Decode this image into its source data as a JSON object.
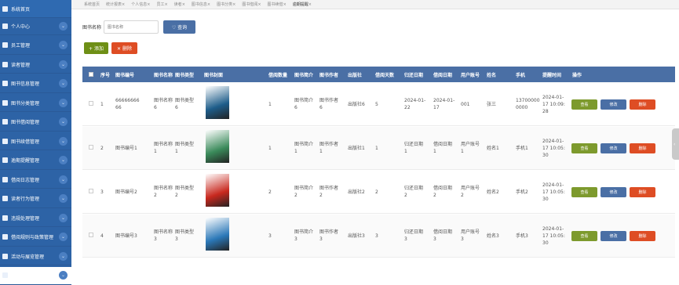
{
  "sidebar": {
    "items": [
      {
        "label": "系统首页",
        "icon": "home-icon"
      },
      {
        "label": "个人中心",
        "icon": "user-icon"
      },
      {
        "label": "员工管理",
        "icon": "staff-icon"
      },
      {
        "label": "读者管理",
        "icon": "reader-icon"
      },
      {
        "label": "图书信息管理",
        "icon": "book-icon"
      },
      {
        "label": "图书分类管理",
        "icon": "category-icon"
      },
      {
        "label": "图书借阅管理",
        "icon": "borrow-icon"
      },
      {
        "label": "图书续借管理",
        "icon": "renew-icon"
      },
      {
        "label": "逾期提醒管理",
        "icon": "bell-icon"
      },
      {
        "label": "借阅日志管理",
        "icon": "log-icon"
      },
      {
        "label": "读者行为管理",
        "icon": "behavior-icon"
      },
      {
        "label": "违规处理管理",
        "icon": "violation-icon"
      },
      {
        "label": "借阅规则与政策管理",
        "icon": "rule-icon"
      },
      {
        "label": "活动与展览管理",
        "icon": "activity-icon"
      },
      {
        "label": "咨询与反馈管理",
        "icon": "feedback-icon"
      }
    ]
  },
  "tabs": [
    "系统首页",
    "统计报表",
    "个人信息",
    "员工",
    "读者",
    "图书信息",
    "图书分类",
    "图书借阅",
    "图书续借",
    "逾期提醒"
  ],
  "search": {
    "label": "图书名称",
    "placeholder": "图书名称",
    "button": "查询"
  },
  "toolbar": {
    "add": "添加",
    "delete": "删除"
  },
  "table": {
    "headers": [
      "序号",
      "图书编号",
      "图书名称",
      "图书类型",
      "图书封面",
      "借阅数量",
      "图书简介",
      "图书作者",
      "出版社",
      "借阅天数",
      "归还日期",
      "借阅日期",
      "用户账号",
      "姓名",
      "手机",
      "提醒时间",
      "操作"
    ],
    "actions": {
      "view": "查看",
      "edit": "修改",
      "delete": "删除"
    },
    "rows": [
      {
        "index": "1",
        "book_no": "66666666\n66",
        "book_name": "图书名称\n6",
        "book_type": "图书类型\n6",
        "quantity": "1",
        "intro": "图书简介\n6",
        "author": "图书作者\n6",
        "publisher": "出版社6",
        "days": "5",
        "return_date": "2024-01-\n22",
        "borrow_date": "2024-01-\n17",
        "account": "001",
        "name": "张三",
        "phone": "13700000\n0000",
        "remind": "2024-01-\n17 10:09:\n28",
        "cover_color": "#1e5d8a"
      },
      {
        "index": "2",
        "book_no": "图书编号1",
        "book_name": "图书名称\n1",
        "book_type": "图书类型\n1",
        "quantity": "1",
        "intro": "图书简介\n1",
        "author": "图书作者\n1",
        "publisher": "出版社1",
        "days": "1",
        "return_date": "归还日期\n1",
        "borrow_date": "借阅日期\n1",
        "account": "用户账号\n1",
        "name": "姓名1",
        "phone": "手机1",
        "remind": "2024-01-\n17 10:05:\n30",
        "cover_color": "#3a8a5a"
      },
      {
        "index": "3",
        "book_no": "图书编号2",
        "book_name": "图书名称\n2",
        "book_type": "图书类型\n2",
        "quantity": "2",
        "intro": "图书简介\n2",
        "author": "图书作者\n2",
        "publisher": "出版社2",
        "days": "2",
        "return_date": "归还日期\n2",
        "borrow_date": "借阅日期\n2",
        "account": "用户账号\n2",
        "name": "姓名2",
        "phone": "手机2",
        "remind": "2024-01-\n17 10:05:\n30",
        "cover_color": "#c8281e"
      },
      {
        "index": "4",
        "book_no": "图书编号3",
        "book_name": "图书名称\n3",
        "book_type": "图书类型\n3",
        "quantity": "3",
        "intro": "图书简介\n3",
        "author": "图书作者\n3",
        "publisher": "出版社3",
        "days": "3",
        "return_date": "归还日期\n3",
        "borrow_date": "借阅日期\n3",
        "account": "用户账号\n3",
        "name": "姓名3",
        "phone": "手机3",
        "remind": "2024-01-\n17 10:05:\n30",
        "cover_color": "#2b78b8"
      }
    ]
  }
}
